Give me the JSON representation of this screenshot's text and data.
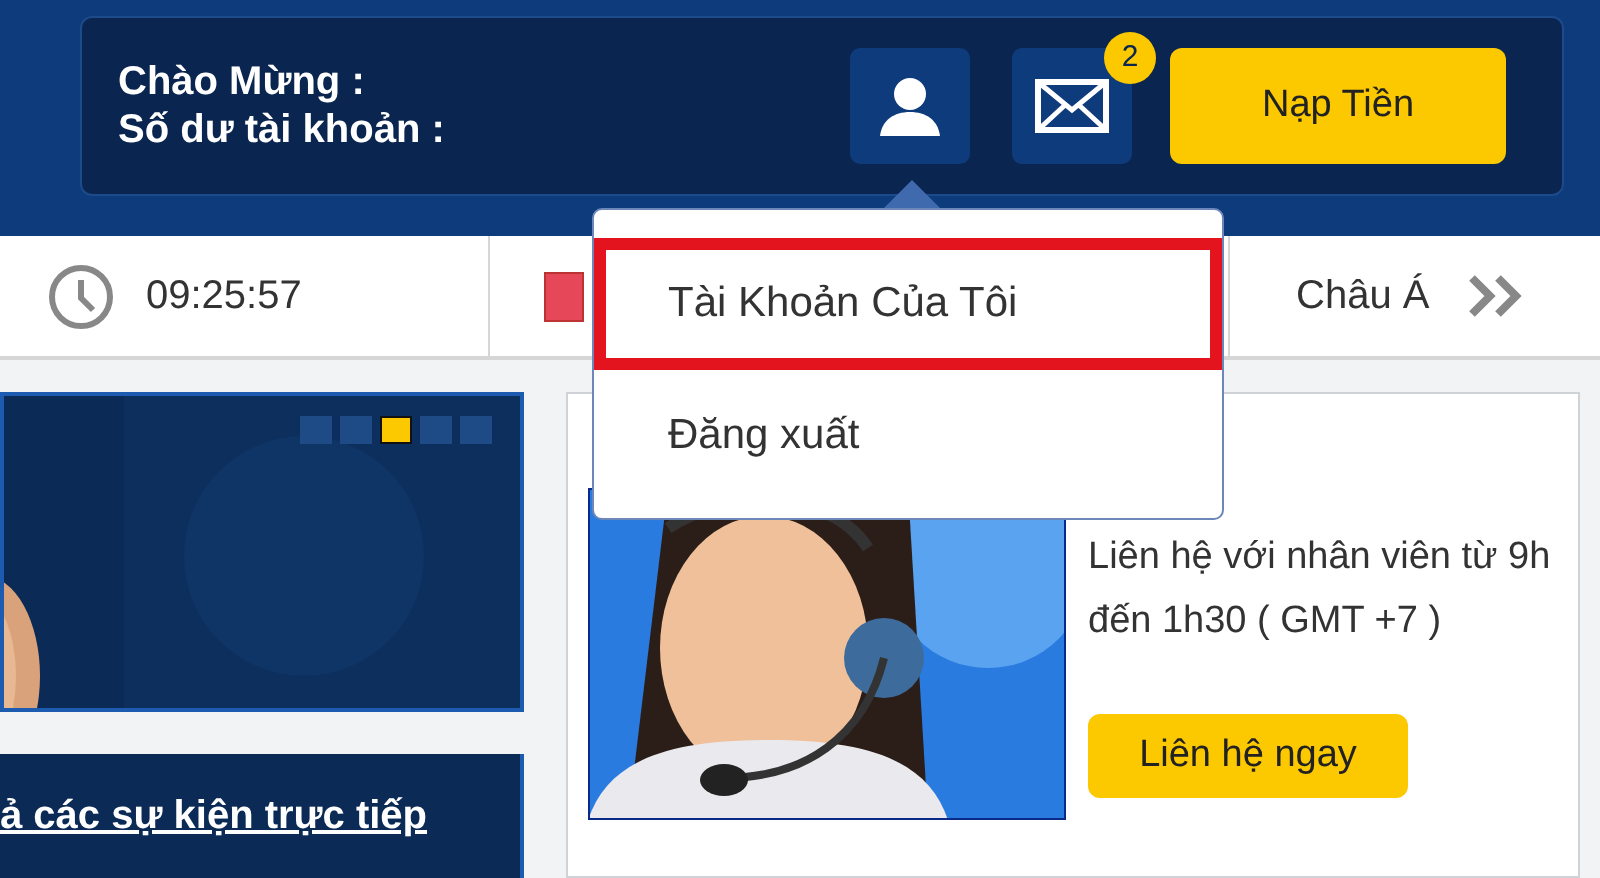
{
  "header": {
    "welcome_label": "Chào Mừng :",
    "balance_label": "Số dư tài khoản :",
    "mail_badge": "2",
    "deposit_button": "Nạp Tiền"
  },
  "account_menu": {
    "expanded": true,
    "items": [
      {
        "label": "Tài Khoản Của Tôi",
        "highlighted": true
      },
      {
        "label": "Đăng xuất",
        "highlighted": false
      }
    ]
  },
  "ticker": {
    "time": "09:25:57",
    "region": "Châu Á"
  },
  "banner": {
    "slides": [
      {
        "selected": false
      },
      {
        "selected": false
      },
      {
        "selected": true
      },
      {
        "selected": false
      },
      {
        "selected": false
      }
    ]
  },
  "headline": "ả các sự kiện trực tiếp",
  "support": {
    "text": "Liên hệ với nhân viên từ 9h đến 1h30 ( GMT +7 )",
    "button": "Liên hệ ngay"
  }
}
